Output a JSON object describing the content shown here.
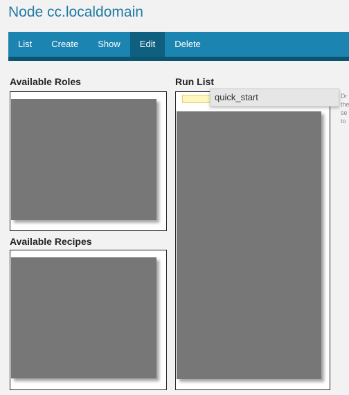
{
  "page": {
    "title": "Node cc.localdomain"
  },
  "nav": {
    "items": [
      {
        "label": "List",
        "active": false
      },
      {
        "label": "Create",
        "active": false
      },
      {
        "label": "Show",
        "active": false
      },
      {
        "label": "Edit",
        "active": true
      },
      {
        "label": "Delete",
        "active": false
      }
    ]
  },
  "sections": {
    "available_roles": "Available Roles",
    "available_recipes": "Available Recipes",
    "run_list": "Run List"
  },
  "run_list": {
    "dragging_item": "quick_start",
    "hint_lines": [
      "Dr",
      "the",
      "se",
      "to"
    ]
  },
  "colors": {
    "title": "#1f7aa3",
    "nav_bg": "#1b84b0",
    "nav_active": "#0f5f80",
    "nav_border": "#0d5471",
    "placeholder": "#fff7c0"
  }
}
